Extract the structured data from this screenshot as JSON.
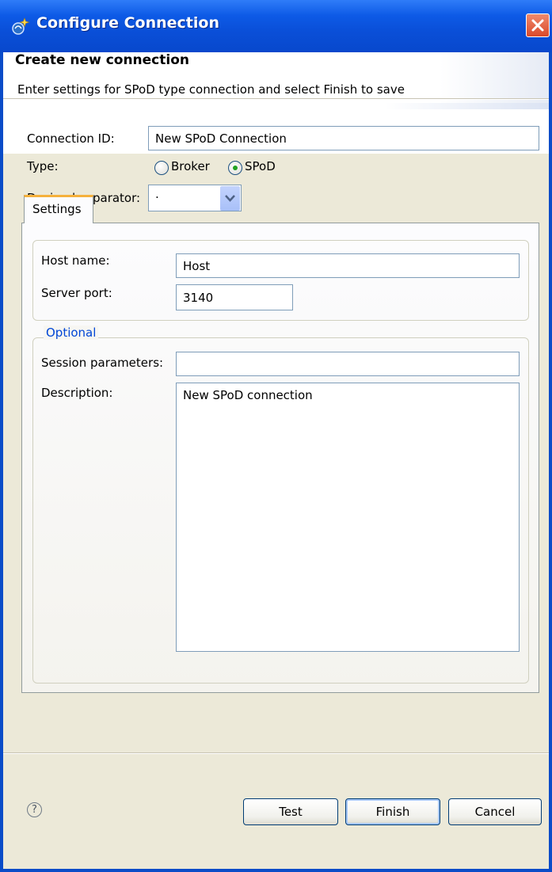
{
  "window": {
    "title": "Configure Connection",
    "icon": "connection-wizard-icon",
    "close_icon": "close-icon"
  },
  "banner": {
    "title": "Create new connection",
    "subtitle": "Enter settings for SPoD type connection and select Finish to save"
  },
  "form": {
    "connection_id_label": "Connection ID:",
    "connection_id_value": "New SPoD Connection",
    "type_label": "Type:",
    "type_options": [
      {
        "label": "Broker",
        "selected": false
      },
      {
        "label": "SPoD",
        "selected": true
      }
    ],
    "decimal_separator_label": "Decimal separator:",
    "decimal_separator_value": "."
  },
  "tabs": [
    {
      "label": "Settings",
      "active": true
    }
  ],
  "settings": {
    "host_name_label": "Host name:",
    "host_name_value": "Host",
    "server_port_label": "Server port:",
    "server_port_value": "3140",
    "optional_group_title": "Optional",
    "session_parameters_label": "Session parameters:",
    "session_parameters_value": "",
    "description_label": "Description:",
    "description_value": "New SPoD connection"
  },
  "footer": {
    "help_icon": "help-icon",
    "help_glyph": "?",
    "test_label": "Test",
    "finish_label": "Finish",
    "cancel_label": "Cancel"
  },
  "colors": {
    "title_bar": "#0a4fd8",
    "dialog_bg": "#ece9d8",
    "tab_accent": "#f5b13c",
    "group_title": "#0046d5",
    "radio_selected": "#21a121"
  }
}
